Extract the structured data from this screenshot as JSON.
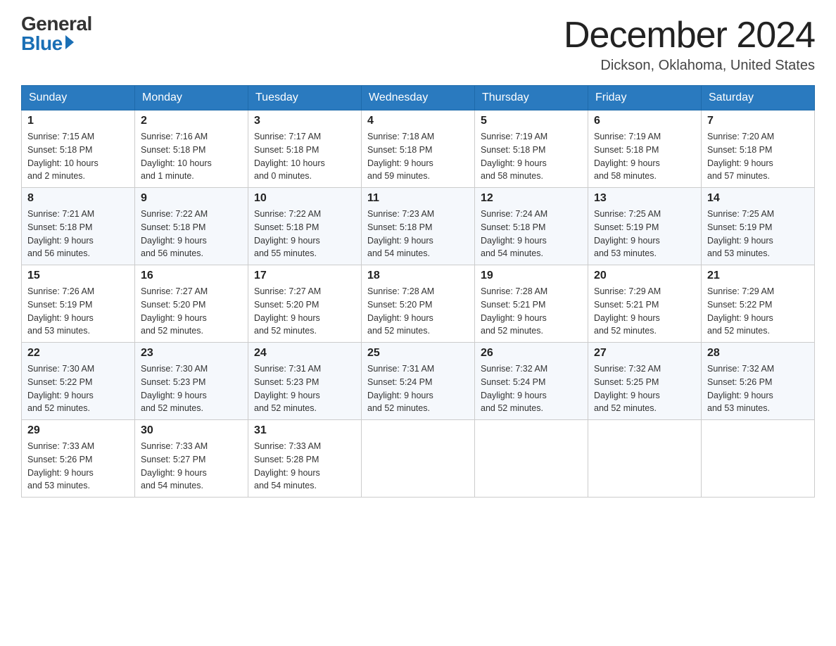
{
  "logo": {
    "general": "General",
    "blue": "Blue"
  },
  "title": {
    "month_year": "December 2024",
    "location": "Dickson, Oklahoma, United States"
  },
  "headers": [
    "Sunday",
    "Monday",
    "Tuesday",
    "Wednesday",
    "Thursday",
    "Friday",
    "Saturday"
  ],
  "weeks": [
    [
      {
        "day": "1",
        "sunrise": "7:15 AM",
        "sunset": "5:18 PM",
        "daylight": "10 hours and 2 minutes."
      },
      {
        "day": "2",
        "sunrise": "7:16 AM",
        "sunset": "5:18 PM",
        "daylight": "10 hours and 1 minute."
      },
      {
        "day": "3",
        "sunrise": "7:17 AM",
        "sunset": "5:18 PM",
        "daylight": "10 hours and 0 minutes."
      },
      {
        "day": "4",
        "sunrise": "7:18 AM",
        "sunset": "5:18 PM",
        "daylight": "9 hours and 59 minutes."
      },
      {
        "day": "5",
        "sunrise": "7:19 AM",
        "sunset": "5:18 PM",
        "daylight": "9 hours and 58 minutes."
      },
      {
        "day": "6",
        "sunrise": "7:19 AM",
        "sunset": "5:18 PM",
        "daylight": "9 hours and 58 minutes."
      },
      {
        "day": "7",
        "sunrise": "7:20 AM",
        "sunset": "5:18 PM",
        "daylight": "9 hours and 57 minutes."
      }
    ],
    [
      {
        "day": "8",
        "sunrise": "7:21 AM",
        "sunset": "5:18 PM",
        "daylight": "9 hours and 56 minutes."
      },
      {
        "day": "9",
        "sunrise": "7:22 AM",
        "sunset": "5:18 PM",
        "daylight": "9 hours and 56 minutes."
      },
      {
        "day": "10",
        "sunrise": "7:22 AM",
        "sunset": "5:18 PM",
        "daylight": "9 hours and 55 minutes."
      },
      {
        "day": "11",
        "sunrise": "7:23 AM",
        "sunset": "5:18 PM",
        "daylight": "9 hours and 54 minutes."
      },
      {
        "day": "12",
        "sunrise": "7:24 AM",
        "sunset": "5:18 PM",
        "daylight": "9 hours and 54 minutes."
      },
      {
        "day": "13",
        "sunrise": "7:25 AM",
        "sunset": "5:19 PM",
        "daylight": "9 hours and 53 minutes."
      },
      {
        "day": "14",
        "sunrise": "7:25 AM",
        "sunset": "5:19 PM",
        "daylight": "9 hours and 53 minutes."
      }
    ],
    [
      {
        "day": "15",
        "sunrise": "7:26 AM",
        "sunset": "5:19 PM",
        "daylight": "9 hours and 53 minutes."
      },
      {
        "day": "16",
        "sunrise": "7:27 AM",
        "sunset": "5:20 PM",
        "daylight": "9 hours and 52 minutes."
      },
      {
        "day": "17",
        "sunrise": "7:27 AM",
        "sunset": "5:20 PM",
        "daylight": "9 hours and 52 minutes."
      },
      {
        "day": "18",
        "sunrise": "7:28 AM",
        "sunset": "5:20 PM",
        "daylight": "9 hours and 52 minutes."
      },
      {
        "day": "19",
        "sunrise": "7:28 AM",
        "sunset": "5:21 PM",
        "daylight": "9 hours and 52 minutes."
      },
      {
        "day": "20",
        "sunrise": "7:29 AM",
        "sunset": "5:21 PM",
        "daylight": "9 hours and 52 minutes."
      },
      {
        "day": "21",
        "sunrise": "7:29 AM",
        "sunset": "5:22 PM",
        "daylight": "9 hours and 52 minutes."
      }
    ],
    [
      {
        "day": "22",
        "sunrise": "7:30 AM",
        "sunset": "5:22 PM",
        "daylight": "9 hours and 52 minutes."
      },
      {
        "day": "23",
        "sunrise": "7:30 AM",
        "sunset": "5:23 PM",
        "daylight": "9 hours and 52 minutes."
      },
      {
        "day": "24",
        "sunrise": "7:31 AM",
        "sunset": "5:23 PM",
        "daylight": "9 hours and 52 minutes."
      },
      {
        "day": "25",
        "sunrise": "7:31 AM",
        "sunset": "5:24 PM",
        "daylight": "9 hours and 52 minutes."
      },
      {
        "day": "26",
        "sunrise": "7:32 AM",
        "sunset": "5:24 PM",
        "daylight": "9 hours and 52 minutes."
      },
      {
        "day": "27",
        "sunrise": "7:32 AM",
        "sunset": "5:25 PM",
        "daylight": "9 hours and 52 minutes."
      },
      {
        "day": "28",
        "sunrise": "7:32 AM",
        "sunset": "5:26 PM",
        "daylight": "9 hours and 53 minutes."
      }
    ],
    [
      {
        "day": "29",
        "sunrise": "7:33 AM",
        "sunset": "5:26 PM",
        "daylight": "9 hours and 53 minutes."
      },
      {
        "day": "30",
        "sunrise": "7:33 AM",
        "sunset": "5:27 PM",
        "daylight": "9 hours and 54 minutes."
      },
      {
        "day": "31",
        "sunrise": "7:33 AM",
        "sunset": "5:28 PM",
        "daylight": "9 hours and 54 minutes."
      },
      null,
      null,
      null,
      null
    ]
  ],
  "labels": {
    "sunrise": "Sunrise:",
    "sunset": "Sunset:",
    "daylight": "Daylight:"
  }
}
